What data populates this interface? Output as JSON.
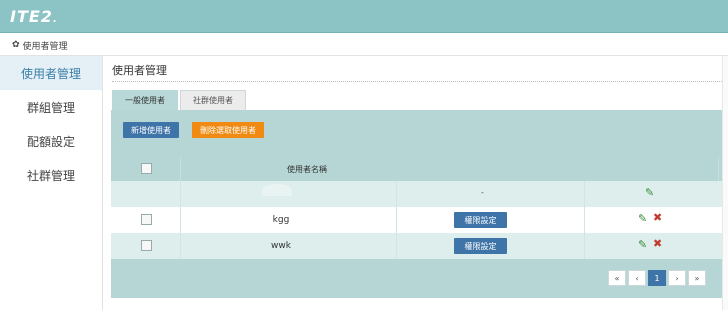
{
  "app": {
    "logo_main": "ITE2",
    "logo_dot": "."
  },
  "breadcrumb": {
    "icon": "gear-icon",
    "label": "使用者管理"
  },
  "sidebar": {
    "items": [
      {
        "label": "使用者管理",
        "active": true
      },
      {
        "label": "群組管理",
        "active": false
      },
      {
        "label": "配額設定",
        "active": false
      },
      {
        "label": "社群管理",
        "active": false
      }
    ]
  },
  "main": {
    "title": "使用者管理",
    "tabs": [
      {
        "label": "一般使用者",
        "active": true
      },
      {
        "label": "社群使用者",
        "active": false
      }
    ],
    "buttons": {
      "add_user": "新增使用者",
      "delete_selected": "刪除選取使用者"
    },
    "table": {
      "column_username": "使用者名稱",
      "rows": [
        {
          "username": "",
          "permission": "-",
          "has_delete": false
        },
        {
          "username": "kgg",
          "permission_button": "權限設定",
          "has_delete": true
        },
        {
          "username": "wwk",
          "permission_button": "權限設定",
          "has_delete": true
        }
      ]
    },
    "pagination": {
      "first": "«",
      "prev": "‹",
      "current": "1",
      "next": "›",
      "last": "»"
    }
  },
  "colors": {
    "topbar": "#8cc3c4",
    "panel": "#b5d6d5",
    "primary_button": "#3f74a8",
    "danger_button": "#f08a12",
    "edit_icon": "#3a8a3a",
    "delete_icon": "#c0392b"
  }
}
